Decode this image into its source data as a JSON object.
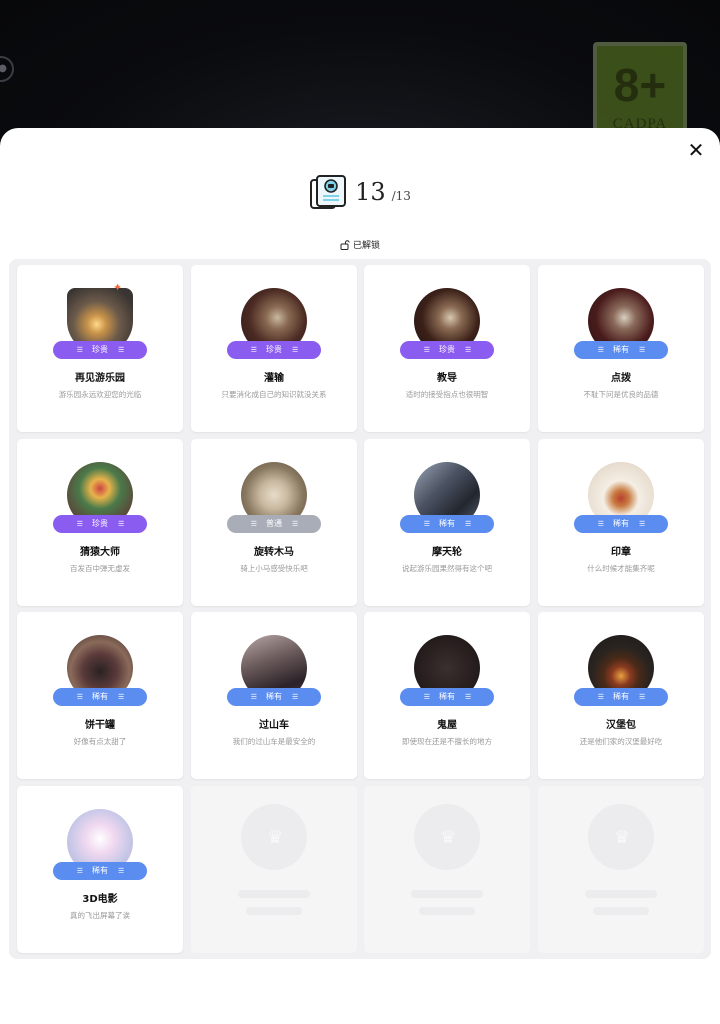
{
  "background": {
    "rating_number": "8+",
    "rating_label": "CADPA",
    "left_icon": "gamepad-icon"
  },
  "header": {
    "collected": "13",
    "total": "/13",
    "unlocked_label": "已解锁",
    "album_icon": "photo-album-icon",
    "close_icon": "close-icon"
  },
  "rarity_labels": {
    "precious": "珍贵",
    "rare": "稀有",
    "common": "普通"
  },
  "cards": [
    {
      "title": "再见游乐园",
      "desc": "游乐园永远欢迎您的光临",
      "rarity": "珍贵"
    },
    {
      "title": "灌输",
      "desc": "只要消化成自己的知识就没关系",
      "rarity": "珍贵"
    },
    {
      "title": "教导",
      "desc": "适时的接受指点也很明智",
      "rarity": "珍贵"
    },
    {
      "title": "点拨",
      "desc": "不耻下问是优良的品德",
      "rarity": "稀有"
    },
    {
      "title": "猜猿大师",
      "desc": "百发百中弹无虚发",
      "rarity": "珍贵"
    },
    {
      "title": "旋转木马",
      "desc": "骑上小马感受快乐吧",
      "rarity": "普通"
    },
    {
      "title": "摩天轮",
      "desc": "说起游乐园果然得有这个吧",
      "rarity": "稀有"
    },
    {
      "title": "印章",
      "desc": "什么时候才能集齐呢",
      "rarity": "稀有"
    },
    {
      "title": "饼干罐",
      "desc": "好像有点太甜了",
      "rarity": "稀有"
    },
    {
      "title": "过山车",
      "desc": "我们的过山车是最安全的",
      "rarity": "稀有"
    },
    {
      "title": "鬼屋",
      "desc": "即使现在还是不擅长的地方",
      "rarity": "稀有"
    },
    {
      "title": "汉堡包",
      "desc": "还是他们家的汉堡最好吃",
      "rarity": "稀有"
    },
    {
      "title": "3D电影",
      "desc": "真的飞出屏幕了诶",
      "rarity": "稀有"
    }
  ],
  "colors": {
    "precious": "#8b5cf0",
    "rare": "#5b8df0",
    "common": "#a8adb8"
  }
}
